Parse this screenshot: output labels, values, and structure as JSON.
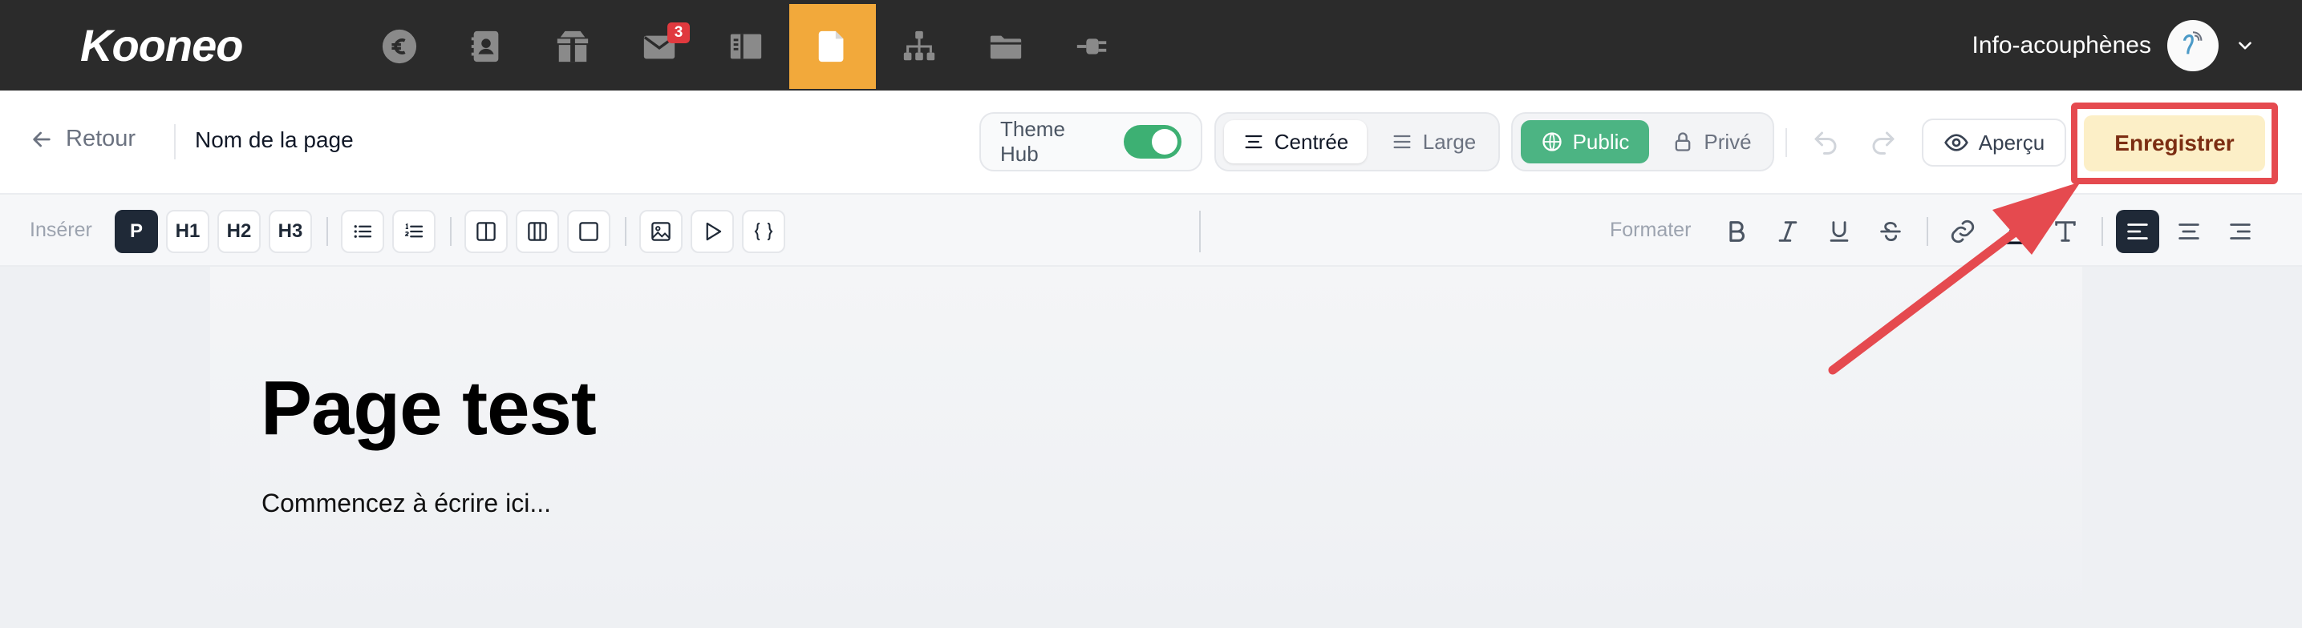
{
  "app": {
    "logo": "Kooneo"
  },
  "topnav": {
    "icons": [
      {
        "name": "euro-icon"
      },
      {
        "name": "contacts-icon"
      },
      {
        "name": "package-icon"
      },
      {
        "name": "mail-icon",
        "badge": "3"
      },
      {
        "name": "layout-icon"
      },
      {
        "name": "page-icon",
        "active": true
      },
      {
        "name": "sitemap-icon"
      },
      {
        "name": "folder-icon"
      },
      {
        "name": "plug-icon"
      }
    ],
    "account_name": "Info-acouphènes"
  },
  "header": {
    "back_label": "Retour",
    "page_name": "Nom de la page",
    "theme_hub_label": "Theme Hub",
    "theme_hub_on": true,
    "width_options": [
      "Centrée",
      "Large"
    ],
    "width_selected": "Centrée",
    "visibility_options": [
      "Public",
      "Privé"
    ],
    "visibility_selected": "Public",
    "preview_label": "Aperçu",
    "save_label": "Enregistrer"
  },
  "toolbar": {
    "insert_label": "Insérer",
    "block_types": [
      "P",
      "H1",
      "H2",
      "H3"
    ],
    "block_selected": "P",
    "format_label": "Formater",
    "alignment_selected": "left"
  },
  "editor": {
    "title": "Page test",
    "placeholder": "Commencez à écrire ici..."
  },
  "colors": {
    "topnav_bg": "#2b2b2b",
    "active_nav": "#f2a93b",
    "green": "#4cb483",
    "save_bg": "#fcefc7",
    "annotation_red": "#e54a4f"
  }
}
